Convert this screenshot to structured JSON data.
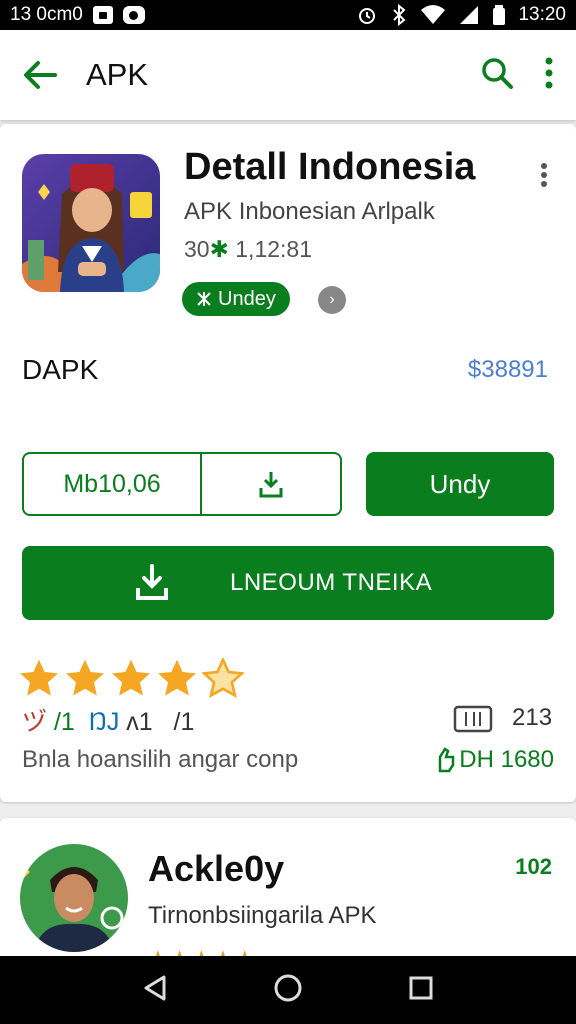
{
  "status_bar": {
    "left_text": "13 0cm0",
    "time": "13:20"
  },
  "app_bar": {
    "title": "APK"
  },
  "app": {
    "title": "Detall Indonesia",
    "subtitle": "APK Inbonesian Arlpalk",
    "meta_prefix": "30",
    "meta_star": "✱",
    "meta_value": " 1,12:81",
    "badge_label": "Undey",
    "info_glyph": "›"
  },
  "row": {
    "label": "DAPK",
    "price": "$38891"
  },
  "buttons": {
    "split_label": "Mb10,06",
    "secondary_label": "Undy",
    "install_label": "LNEOUM TNEIKA"
  },
  "rating": {
    "stars": 5,
    "marks": [
      "ヅ",
      "/1",
      "ŊJ",
      "ʌ1",
      "/1"
    ],
    "review_count": "213",
    "caption": "Bnla hoansilih angar conp",
    "downloads_label": "DH 1680"
  },
  "developer": {
    "name": "Ackle0y",
    "subtitle": "Tirnonbsiingarila APK",
    "badge": "102",
    "stars_text": "★★★★★"
  },
  "colors": {
    "accent": "#0a7d1e",
    "price_blue": "#4a7fd1",
    "star_gold": "#f5a623"
  }
}
